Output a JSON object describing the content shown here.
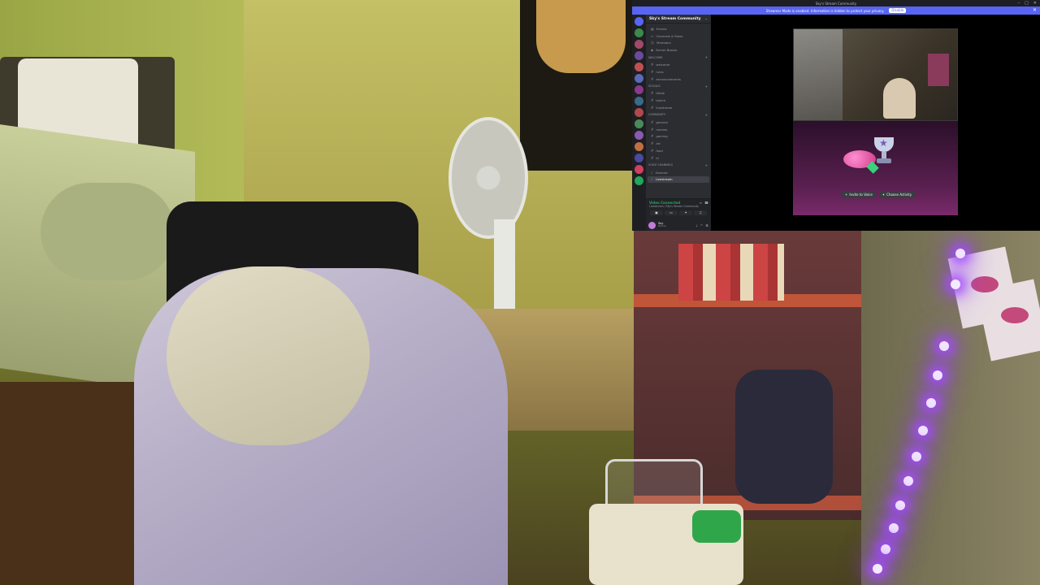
{
  "window": {
    "title": "Sky's Stream Community",
    "controls": [
      "minimize-icon",
      "maximize-icon",
      "close-icon"
    ]
  },
  "banner": {
    "text": "Streamer Mode is enabled. Information is hidden to protect your privacy.",
    "button_label": "Disable",
    "close_glyph": "✕",
    "color": "#5865f2"
  },
  "server": {
    "name": "Sky's Stream Community",
    "chevron": "⌄"
  },
  "channels": {
    "top": [
      {
        "label": "Events",
        "icon": "calendar-icon"
      },
      {
        "label": "Channels & Roles",
        "icon": "list-icon"
      },
      {
        "label": "Members",
        "icon": "members-icon"
      },
      {
        "label": "Server Boosts",
        "icon": "boost-icon"
      }
    ],
    "categories": [
      {
        "name": "Welcome",
        "items": [
          "welcome",
          "rules",
          "announcements"
        ]
      },
      {
        "name": "Socials",
        "items": [
          "tiktok",
          "twitch",
          "livestream"
        ]
      },
      {
        "name": "Community",
        "items": [
          "general",
          "memes",
          "gaming",
          "art",
          "food",
          "irl"
        ]
      },
      {
        "name": "Voice Channels",
        "items": [
          "General",
          "Livestream"
        ]
      }
    ]
  },
  "voice": {
    "status": "Video Connected",
    "sub": "Livestream / Sky's Stream Community",
    "buttons": [
      "camera-icon",
      "screen-share-icon",
      "activity-icon",
      "soundboard-icon"
    ]
  },
  "user": {
    "name": "Sky",
    "status": "Online"
  },
  "activity": {
    "invite_label": "Invite to Voice",
    "choose_label": "Choose Activity"
  },
  "colors": {
    "accent": "#5865f2",
    "online_green": "#23a55a",
    "panel_dark": "#2b2d31",
    "rail": "#1e1f22",
    "led_purple": "#a64dff"
  }
}
